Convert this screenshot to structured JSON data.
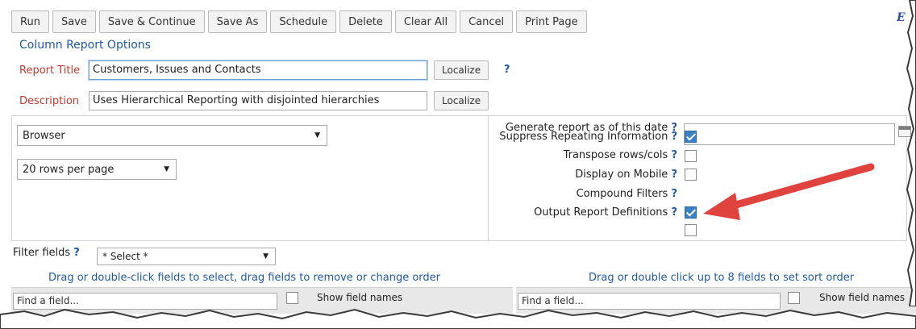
{
  "toolbar": {
    "buttons": [
      "Run",
      "Save",
      "Save & Continue",
      "Save As",
      "Schedule",
      "Delete",
      "Clear All",
      "Cancel",
      "Print Page"
    ],
    "brand_letter": "E"
  },
  "section_title": "Column Report Options",
  "report_title": {
    "label": "Report Title",
    "value": "Customers, Issues and Contacts",
    "localize": "Localize",
    "help": "?"
  },
  "description": {
    "label": "Description",
    "value": "Uses Hierarchical Reporting with disjointed hierarchies",
    "localize": "Localize"
  },
  "output_select": {
    "value": "Browser"
  },
  "rows_select": {
    "value": "20 rows per page"
  },
  "generate_date": {
    "label": "Generate report as of this date",
    "help": "?",
    "value": ""
  },
  "options": [
    {
      "label": "Suppress Repeating Information",
      "help": "?",
      "checked": true
    },
    {
      "label": "Transpose rows/cols",
      "help": "?",
      "checked": false
    },
    {
      "label": "Display on Mobile",
      "help": "?",
      "checked": false
    },
    {
      "label": "Compound Filters",
      "help": "?",
      "checked": true
    },
    {
      "label": "Output Report Definitions",
      "help": "?",
      "checked": false
    }
  ],
  "filter_fields": {
    "label": "Filter fields",
    "help": "?",
    "select_value": "* Select *"
  },
  "hints": {
    "left": "Drag or double-click fields to select, drag fields to remove or change order",
    "right": "Drag or double click up to 8 fields to set sort order"
  },
  "field_search": {
    "placeholder": "Find a field...",
    "show_names": "Show field names"
  },
  "colors": {
    "accent_blue": "#1f5aa6",
    "label_red": "#c0392b",
    "arrow_red": "#e0433d",
    "check_blue": "#3b82c4"
  }
}
